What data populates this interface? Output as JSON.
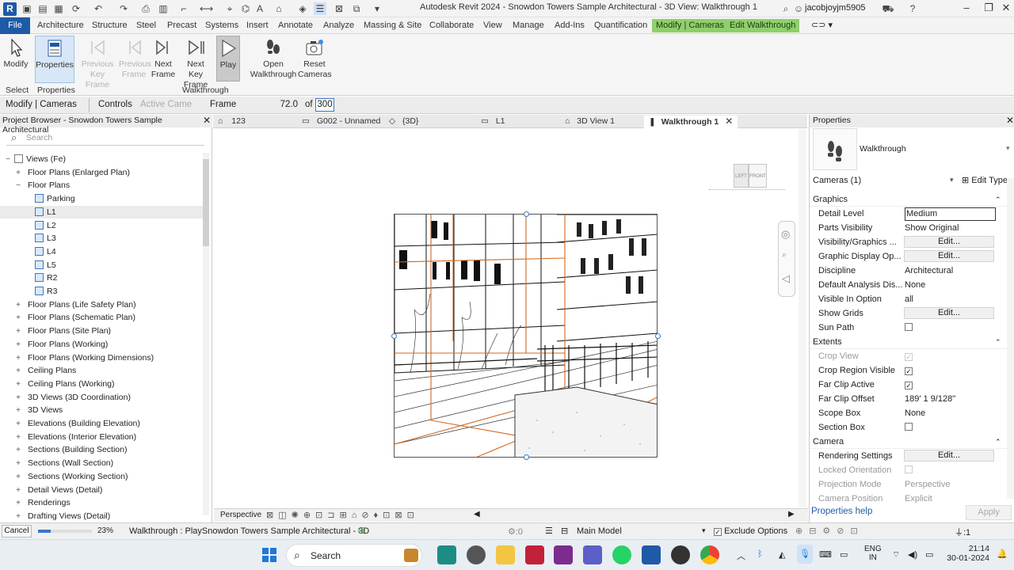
{
  "window": {
    "title": "Autodesk Revit 2024 - Snowdon Towers Sample Architectural - 3D View: Walkthrough 1",
    "user": "jacobjoyjm5905",
    "app_letter": "R"
  },
  "ribbon_tabs": [
    "File",
    "Architecture",
    "Structure",
    "Steel",
    "Precast",
    "Systems",
    "Insert",
    "Annotate",
    "Analyze",
    "Massing & Site",
    "Collaborate",
    "View",
    "Manage",
    "Add-Ins",
    "Quantification"
  ],
  "context_tabs": [
    "Modify | Cameras",
    "Edit Walkthrough"
  ],
  "ribbon": {
    "modify": "Modify",
    "properties": "Properties",
    "prev_key": [
      "Previous",
      "Key Frame"
    ],
    "prev_frame": [
      "Previous",
      "Frame"
    ],
    "next_frame": [
      "Next",
      "Frame"
    ],
    "next_key": [
      "Next",
      "Key Frame"
    ],
    "play": "Play",
    "open_walk": [
      "Open",
      "Walkthrough"
    ],
    "reset_cams": [
      "Reset",
      "Cameras"
    ],
    "panels": {
      "select": "Select",
      "properties": "Properties",
      "walkthrough": "Walkthrough"
    }
  },
  "options_bar": {
    "context": "Modify | Cameras",
    "controls_label": "Controls",
    "controls_value": "Active Came",
    "frame_label": "Frame",
    "frame_value": "72.0",
    "of_label": "of",
    "total_frames": "300"
  },
  "project_browser": {
    "title": "Project Browser - Snowdon Towers Sample Architectural",
    "search_placeholder": "Search",
    "items": [
      {
        "label": "Views (Fe)",
        "tw": "−",
        "level": 0,
        "view": false
      },
      {
        "label": "Floor Plans (Enlarged Plan)",
        "tw": "+",
        "level": 1,
        "view": false
      },
      {
        "label": "Floor Plans",
        "tw": "−",
        "level": 1,
        "view": false
      },
      {
        "label": "Parking",
        "tw": "",
        "level": 2,
        "view": true
      },
      {
        "label": "L1",
        "tw": "",
        "level": 2,
        "view": true,
        "selected": true
      },
      {
        "label": "L2",
        "tw": "",
        "level": 2,
        "view": true
      },
      {
        "label": "L3",
        "tw": "",
        "level": 2,
        "view": true
      },
      {
        "label": "L4",
        "tw": "",
        "level": 2,
        "view": true
      },
      {
        "label": "L5",
        "tw": "",
        "level": 2,
        "view": true
      },
      {
        "label": "R2",
        "tw": "",
        "level": 2,
        "view": true
      },
      {
        "label": "R3",
        "tw": "",
        "level": 2,
        "view": true
      },
      {
        "label": "Floor Plans (Life Safety Plan)",
        "tw": "+",
        "level": 1,
        "view": false
      },
      {
        "label": "Floor Plans (Schematic Plan)",
        "tw": "+",
        "level": 1,
        "view": false
      },
      {
        "label": "Floor Plans (Site Plan)",
        "tw": "+",
        "level": 1,
        "view": false
      },
      {
        "label": "Floor Plans (Working)",
        "tw": "+",
        "level": 1,
        "view": false
      },
      {
        "label": "Floor Plans (Working Dimensions)",
        "tw": "+",
        "level": 1,
        "view": false
      },
      {
        "label": "Ceiling Plans",
        "tw": "+",
        "level": 1,
        "view": false
      },
      {
        "label": "Ceiling Plans (Working)",
        "tw": "+",
        "level": 1,
        "view": false
      },
      {
        "label": "3D Views (3D Coordination)",
        "tw": "+",
        "level": 1,
        "view": false
      },
      {
        "label": "3D Views",
        "tw": "+",
        "level": 1,
        "view": false
      },
      {
        "label": "Elevations (Building Elevation)",
        "tw": "+",
        "level": 1,
        "view": false
      },
      {
        "label": "Elevations (Interior Elevation)",
        "tw": "+",
        "level": 1,
        "view": false
      },
      {
        "label": "Sections (Building Section)",
        "tw": "+",
        "level": 1,
        "view": false
      },
      {
        "label": "Sections (Wall Section)",
        "tw": "+",
        "level": 1,
        "view": false
      },
      {
        "label": "Sections (Working Section)",
        "tw": "+",
        "level": 1,
        "view": false
      },
      {
        "label": "Detail Views (Detail)",
        "tw": "+",
        "level": 1,
        "view": false
      },
      {
        "label": "Renderings",
        "tw": "+",
        "level": 1,
        "view": false
      },
      {
        "label": "Drafting Views (Detail)",
        "tw": "+",
        "level": 1,
        "view": false
      }
    ]
  },
  "view_tabs": [
    {
      "label": "123",
      "active": false
    },
    {
      "label": "G002 - Unnamed",
      "active": false
    },
    {
      "label": "{3D}",
      "active": false
    },
    {
      "label": "L1",
      "active": false
    },
    {
      "label": "3D View 1",
      "active": false
    },
    {
      "label": "Walkthrough 1",
      "active": true
    }
  ],
  "viewcube": {
    "left": "LEFT",
    "front": "FRONT"
  },
  "view_bar": {
    "mode": "Perspective"
  },
  "properties": {
    "title": "Properties",
    "type_name": "Walkthrough",
    "selector": "Cameras (1)",
    "edit_type": "Edit Type",
    "groups": [
      {
        "name": "Graphics",
        "rows": [
          {
            "name": "Detail Level",
            "value": "Medium",
            "kind": "input"
          },
          {
            "name": "Parts Visibility",
            "value": "Show Original",
            "kind": "text"
          },
          {
            "name": "Visibility/Graphics ...",
            "value": "Edit...",
            "kind": "button"
          },
          {
            "name": "Graphic Display Op...",
            "value": "Edit...",
            "kind": "button"
          },
          {
            "name": "Discipline",
            "value": "Architectural",
            "kind": "text"
          },
          {
            "name": "Default Analysis Dis...",
            "value": "None",
            "kind": "text"
          },
          {
            "name": "Visible In Option",
            "value": "all",
            "kind": "text"
          },
          {
            "name": "Show Grids",
            "value": "Edit...",
            "kind": "button"
          },
          {
            "name": "Sun Path",
            "value": "",
            "kind": "check",
            "checked": false
          }
        ]
      },
      {
        "name": "Extents",
        "rows": [
          {
            "name": "Crop View",
            "value": "",
            "kind": "check",
            "checked": true,
            "disabled": true
          },
          {
            "name": "Crop Region Visible",
            "value": "",
            "kind": "check",
            "checked": true
          },
          {
            "name": "Far Clip Active",
            "value": "",
            "kind": "check",
            "checked": true
          },
          {
            "name": "Far Clip Offset",
            "value": "189'  1 9/128\"",
            "kind": "text"
          },
          {
            "name": "Scope Box",
            "value": "None",
            "kind": "text"
          },
          {
            "name": "Section Box",
            "value": "",
            "kind": "check",
            "checked": false
          }
        ]
      },
      {
        "name": "Camera",
        "rows": [
          {
            "name": "Rendering Settings",
            "value": "Edit...",
            "kind": "button"
          },
          {
            "name": "Locked Orientation",
            "value": "",
            "kind": "check",
            "checked": false,
            "disabled": true
          },
          {
            "name": "Projection Mode",
            "value": "Perspective",
            "kind": "text",
            "disabled": true
          },
          {
            "name": "Camera Position",
            "value": "Explicit",
            "kind": "text",
            "disabled": true
          }
        ]
      }
    ],
    "help": "Properties help",
    "apply": "Apply"
  },
  "status_bar": {
    "cancel": "Cancel",
    "progress_pct": "23%",
    "progress": 0.23,
    "message": "Walkthrough : PlaySnowdon Towers Sample Architectural - 3D",
    "worksets": ":0",
    "model": "Main Model",
    "exclude": "Exclude Options",
    "filter": ":1"
  },
  "taskbar": {
    "search": "Search",
    "lang1": "ENG",
    "lang2": "IN",
    "time": "21:14",
    "date": "30-01-2024"
  },
  "colors": {
    "accent": "#1f5aa6",
    "context_tab": "#8fcf6c",
    "play_bg": "#c9c9c9"
  }
}
